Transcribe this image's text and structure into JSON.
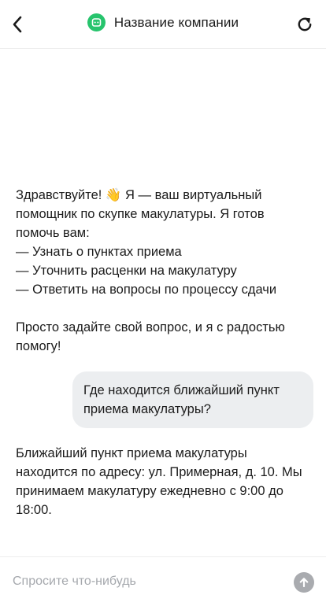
{
  "header": {
    "title": "Название компании",
    "back_icon": "chevron-left-icon",
    "logo_icon": "bot-icon",
    "refresh_icon": "refresh-icon",
    "logo_color": "#27c46d"
  },
  "messages": [
    {
      "role": "bot",
      "lines": [
        "Здравствуйте! 👋 Я — ваш виртуальный",
        "помощник по скупке макулатуры. Я готов",
        "помочь вам:",
        "— Узнать о пунктах приема",
        "— Уточнить расценки на макулатуру",
        "— Ответить на вопросы по процессу сдачи",
        "",
        "Просто задайте свой вопрос, и я с радостью",
        "помогу!"
      ]
    },
    {
      "role": "user",
      "lines": [
        "Где находится ближайший пункт",
        "приема макулатуры?"
      ]
    },
    {
      "role": "bot",
      "lines": [
        "Ближайший пункт приема макулатуры",
        "находится по адресу: ул. Примерная, д. 10. Мы",
        "принимаем макулатуру ежедневно с 9:00 до",
        "18:00."
      ]
    }
  ],
  "composer": {
    "placeholder": "Спросите что-нибудь",
    "value": "",
    "send_icon": "arrow-up-icon",
    "send_color": "#a9abaf"
  },
  "colors": {
    "user_bubble": "#eceef0",
    "text": "#1b1b1b"
  }
}
